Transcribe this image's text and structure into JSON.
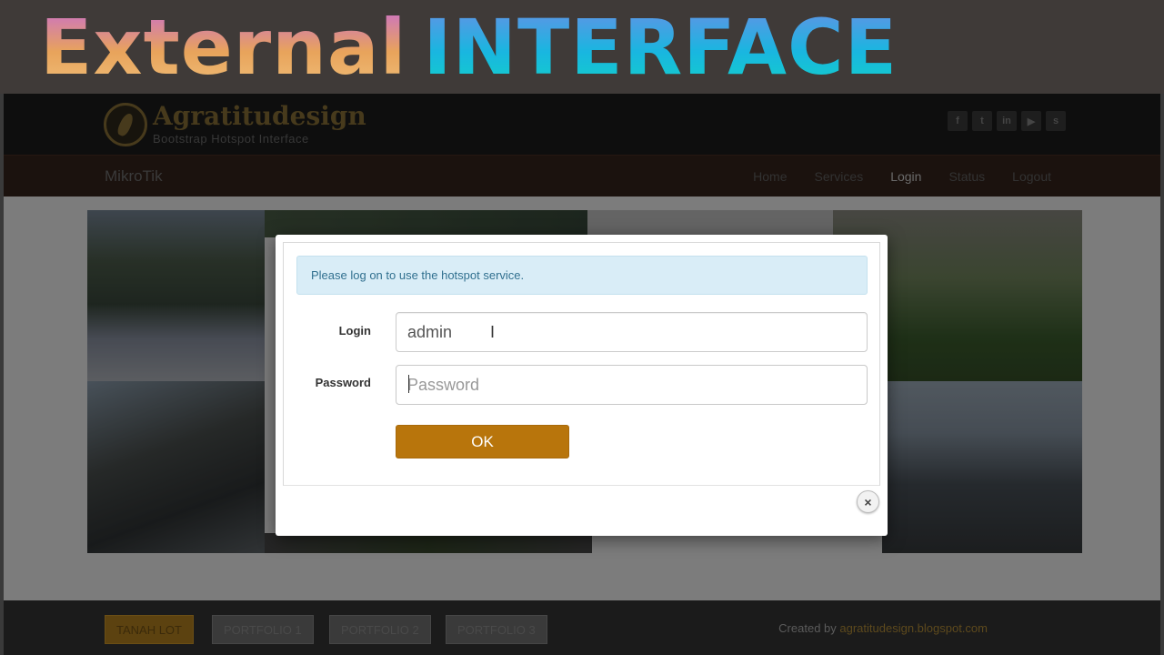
{
  "banner": {
    "word1": "External",
    "word2": "INTERFACE"
  },
  "header": {
    "logo_name": "Agratitudesign",
    "logo_tagline": "Bootstrap Hotspot Interface",
    "social_icons": [
      "facebook-icon",
      "twitter-icon",
      "linkedin-icon",
      "youtube-icon",
      "skype-icon"
    ],
    "social_glyphs": [
      "f",
      "t",
      "in",
      "▶",
      "s"
    ]
  },
  "navbar": {
    "brand": "MikroTik",
    "items": [
      {
        "label": "Home"
      },
      {
        "label": "Services"
      },
      {
        "label": "Login",
        "active": true
      },
      {
        "label": "Status"
      },
      {
        "label": "Logout"
      }
    ]
  },
  "modal": {
    "alert": "Please log on to use the hotspot service.",
    "login_label": "Login",
    "login_value": "admin",
    "password_label": "Password",
    "password_placeholder": "Password",
    "ok_label": "OK",
    "close_glyph": "×"
  },
  "footer": {
    "buttons": [
      "TANAH LOT",
      "PORTFOLIO 1",
      "PORTFOLIO 2",
      "PORTFOLIO 3"
    ],
    "credit_prefix": "Created by",
    "credit_link": "agratitudesign.blogspot.com"
  },
  "colors": {
    "accent": "#b8750c",
    "alert_bg": "#d9edf7",
    "alert_text": "#31708f"
  }
}
